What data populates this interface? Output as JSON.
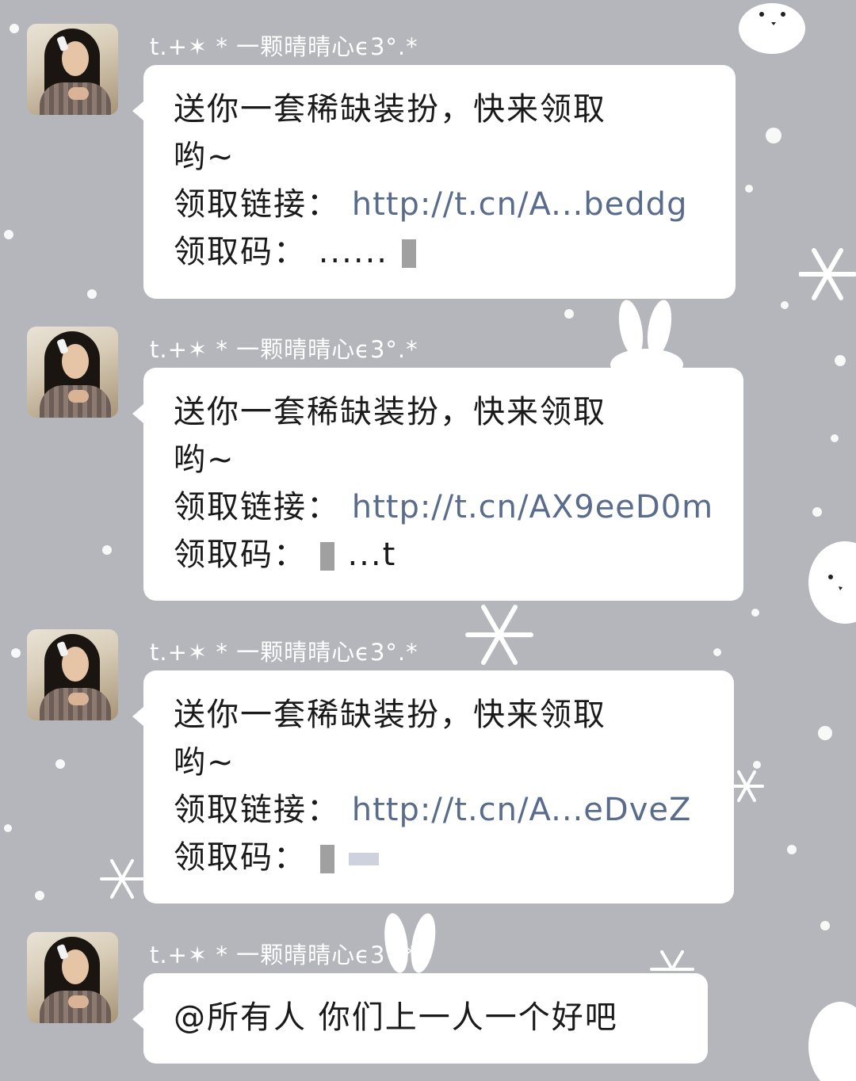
{
  "messages": [
    {
      "sender": "t.+✶ * 一颗晴晴心ϵ3°.*",
      "line1": "送你一套稀缺装扮，快来领取",
      "line2": "哟~",
      "link_label": "领取链接：",
      "link_value": "http://t.cn/A...beddg",
      "code_label": "领取码：",
      "code_value": "......"
    },
    {
      "sender": "t.+✶ * 一颗晴晴心ϵ3°.*",
      "line1": "送你一套稀缺装扮，快来领取",
      "line2": "哟~",
      "link_label": "领取链接：",
      "link_value": "http://t.cn/AX9eeD0m",
      "code_label": "领取码：",
      "code_value": "...t"
    },
    {
      "sender": "t.+✶ * 一颗晴晴心ϵ3°.*",
      "line1": "送你一套稀缺装扮，快来领取",
      "line2": "哟~",
      "link_label": "领取链接：",
      "link_value": "http://t.cn/A...eDveZ",
      "code_label": "领取码：",
      "code_value": ""
    },
    {
      "sender": "t.+✶ * 一颗晴晴心ϵ3°.*",
      "text": "@所有人 你们上一人一个好吧"
    }
  ],
  "icons": {
    "avatar": "avatar-photo-icon",
    "background": "bunny-snowflake-wallpaper"
  },
  "colors": {
    "background": "#b4b6bb",
    "bubble": "#ffffff",
    "link": "#5a6c8c",
    "name": "#ffffff"
  }
}
